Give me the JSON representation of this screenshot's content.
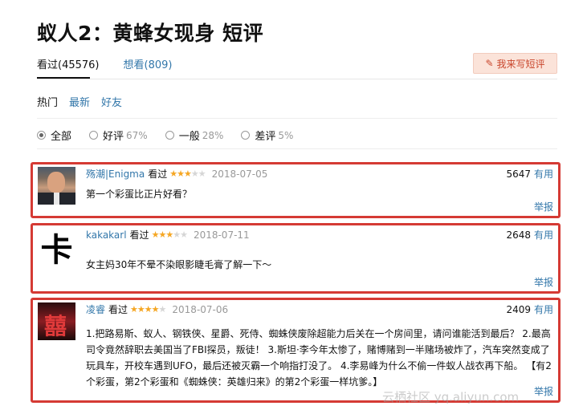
{
  "page": {
    "title": "蚁人2：黄蜂女现身 短评"
  },
  "tabs": [
    {
      "label": "看过(45576)"
    },
    {
      "label": "想看(809)"
    }
  ],
  "write_button": {
    "label": "我来写短评",
    "icon": "pencil-icon"
  },
  "sort": [
    "热门",
    "最新",
    "好友"
  ],
  "filters": [
    {
      "label": "全部",
      "pct": ""
    },
    {
      "label": "好评",
      "pct": "67%"
    },
    {
      "label": "一般",
      "pct": "28%"
    },
    {
      "label": "差评",
      "pct": "5%"
    }
  ],
  "reviews": [
    {
      "user": "殇潮|Enigma",
      "status": "看过",
      "stars": 3,
      "date": "2018-07-05",
      "votes": "5647",
      "useful_label": "有用",
      "content": "第一个彩蛋比正片好看？",
      "report_label": "举报"
    },
    {
      "user": "kakakarl",
      "status": "看过",
      "stars": 3,
      "date": "2018-07-11",
      "votes": "2648",
      "useful_label": "有用",
      "avatar_char": "卡",
      "content": "女主妈30年不晕不染眼影睫毛膏了解一下～",
      "report_label": "举报"
    },
    {
      "user": "凌睿",
      "status": "看过",
      "stars": 4,
      "date": "2018-07-06",
      "votes": "2409",
      "useful_label": "有用",
      "avatar_char": "囍",
      "content": "1.把路易斯、蚁人、钢铁侠、星爵、死侍、蜘蛛侠废除超能力后关在一个房间里，请问谁能活到最后？ 2.最高司令竟然辞职去美国当了FBI探员，叛徒！ 3.斯坦·李今年太惨了，赌博赌到一半赌场被炸了，汽车突然变成了玩具车，开校车遇到UFO，最后还被灭霸一个响指打没了。 4.李易峰为什么不偷一件蚁人战衣再下船。 【有2个彩蛋，第2个彩蛋和《蜘蛛侠：英雄归来》的第2个彩蛋一样坑爹。】",
      "report_label": "举报"
    }
  ],
  "watermark": "云栖社区 yq.aliyun.com",
  "colors": {
    "link": "#3377aa",
    "highlight_border": "#d53a34",
    "star": "#f5a623"
  }
}
